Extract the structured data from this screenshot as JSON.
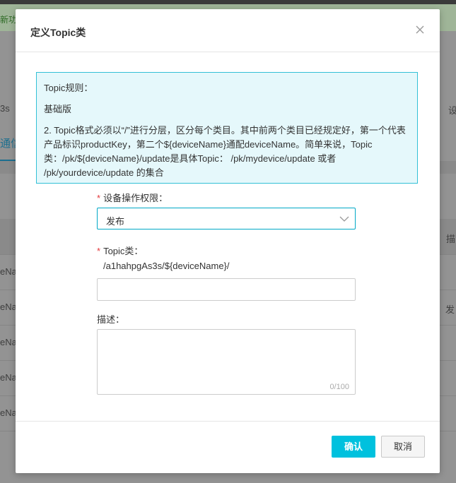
{
  "background": {
    "notice_text": "新功能",
    "fragments": {
      "left_top": "3s",
      "right_top": "设",
      "tab": "通信",
      "right_desc": "描",
      "right_pub": "发",
      "row_prefix": "eNa"
    }
  },
  "modal": {
    "title": "定义Topic类",
    "info": {
      "title": "Topic规则：",
      "subtitle": "基础版",
      "description": "2. Topic格式必须以“/”进行分层，区分每个类目。其中前两个类目已经规定好，第一个代表产品标识productKey，第二个${deviceName}通配deviceName。简单来说，Topic类：/pk/${deviceName}/update是具体Topic： /pk/mydevice/update 或者 /pk/yourdevice/update 的集合"
    },
    "form": {
      "permission_label": "设备操作权限：",
      "permission_value": "发布",
      "topic_label": "Topic类：",
      "topic_prefix": "/a1hahpgAs3s/${deviceName}/",
      "topic_value": "",
      "desc_label": "描述：",
      "desc_value": "",
      "char_count": "0/100",
      "required_mark": "*"
    },
    "footer": {
      "confirm_label": "确认",
      "cancel_label": "取消"
    }
  },
  "colors": {
    "accent": "#00c1de",
    "info_border": "#33c0d6",
    "info_bg": "#e5f8fb",
    "required": "#e4393c"
  },
  "icons": {
    "close": "close-icon",
    "dropdown": "chevron-down-icon"
  }
}
